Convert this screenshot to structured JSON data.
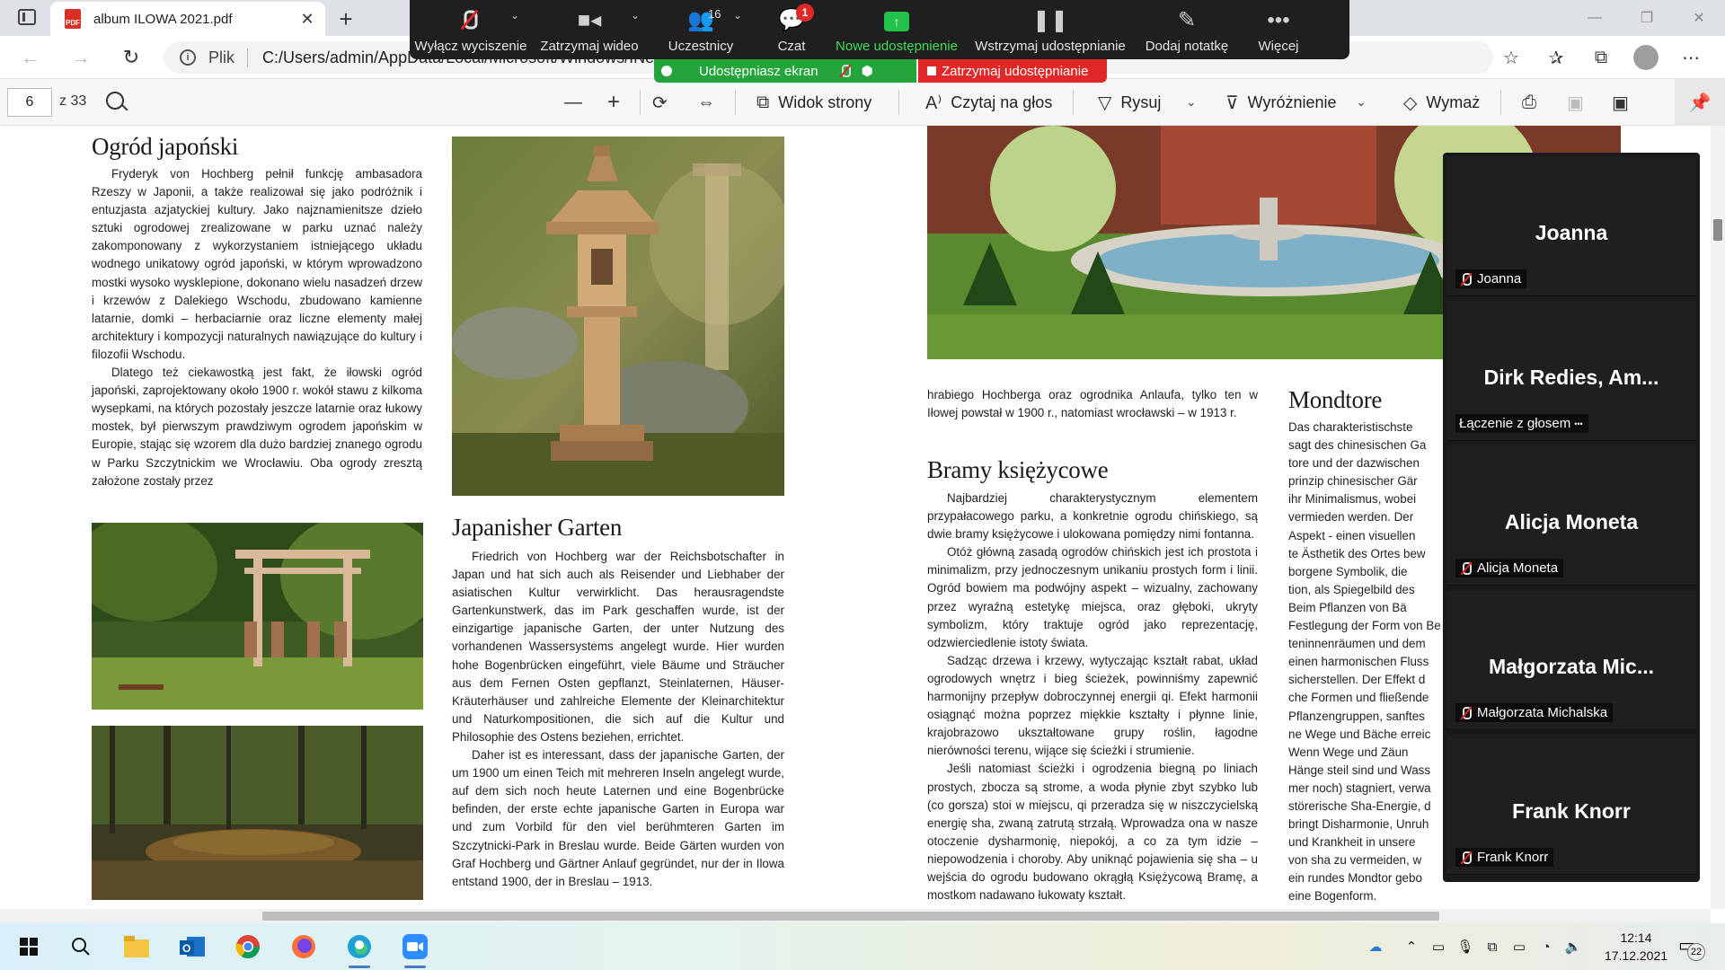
{
  "browser": {
    "tab_title": "album ILOWA 2021.pdf",
    "url_scheme": "Plik",
    "url": "C:/Users/admin/AppData/Local/Microsoft/Windows/INetCache/IE/album%20ILOWA%202021.pdf"
  },
  "pdf_toolbar": {
    "page_current": "6",
    "page_total": "z 33",
    "page_view": "Widok strony",
    "read_aloud": "Czytaj na głos",
    "draw": "Rysuj",
    "highlight": "Wyróżnienie",
    "erase": "Wymaż"
  },
  "zoom_bar": {
    "unmute": "Wyłącz wyciszenie",
    "stop_video": "Zatrzymaj wideo",
    "participants": "Uczestnicy",
    "participants_count": "16",
    "chat": "Czat",
    "chat_badge": "1",
    "new_share": "Nowe udostępnienie",
    "pause_share": "Wstrzymaj udostępnianie",
    "annotate": "Dodaj notatkę",
    "more": "Więcej",
    "sharing_status": "Udostępniasz ekran",
    "stop_sharing": "Zatrzymaj udostępnianie"
  },
  "document": {
    "left_page": {
      "title_pl": "Ogród japoński",
      "text_pl": [
        "Fryderyk von Hochberg pełnił funkcję ambasadora Rzeszy w Japonii, a także realizował się jako podróżnik i entuzjasta azjatyckiej kultury. Jako najznamienitsze dzieło sztuki ogrodowej zrealizowane w parku uznać należy zakomponowany z wykorzystaniem istniejącego układu wodnego unikatowy ogród japoński, w którym wprowadzono mostki wysoko wysklepione, dokonano wielu nasadzeń drzew i krzewów z Dalekiego Wschodu, zbudowano kamienne latarnie, domki – herbaciarnie oraz liczne elementy małej architektury i kompozycji naturalnych nawiązujące do kultury i filozofii Wschodu.",
        "Dlatego też ciekawostką jest fakt, że iłowski ogród japoński, zaprojektowany około 1900 r. wokół stawu z kilkoma wysepkami, na których pozostały jeszcze latarnie oraz łukowy mostek, był pierwszym prawdziwym ogrodem japońskim w Europie, stając się wzorem dla dużo bardziej znanego ogrodu w Parku Szczytnickim we Wrocławiu. Oba ogrody zresztą założone zostały przez"
      ],
      "title_de": "Japanisher Garten",
      "text_de": [
        "Friedrich von Hochberg war der Reichsbotschafter in Japan und hat sich auch als Reisender und Liebhaber der asiatischen Kultur verwirklicht. Das herausragendste Gartenkunstwerk, das im Park geschaffen wurde, ist der einzigartige japanische Garten, der unter Nutzung des vorhandenen Wassersystems angelegt wurde. Hier wurden hohe Bogenbrücken eingeführt, viele Bäume und Sträucher aus dem Fernen Osten gepflanzt, Steinlaternen, Häuser-Kräuterhäuser und zahlreiche Elemente der Kleinarchitektur und Naturkompositionen, die sich auf die Kultur und Philosophie des Ostens beziehen, errichtet.",
        "Daher ist es interessant, dass der japanische Garten, der um 1900 um einen Teich mit mehreren Inseln angelegt wurde, auf dem sich noch heute Laternen und eine Bogenbrücke befinden, der erste echte japanische Garten in Europa war und zum Vorbild für den viel berühmteren Garten im Szczytnicki-Park in Breslau wurde. Beide Gärten wurden von Graf Hochberg und Gärtner Anlauf gegründet, nur der in Ilowa entstand 1900, der in Breslau – 1913."
      ]
    },
    "right_page": {
      "text_cont": "hrabiego Hochberga oraz ogrodnika Anlaufa, tylko ten w Iłowej powstał w 1900 r., natomiast wrocławski – w 1913 r.",
      "title_pl": "Bramy księżycowe",
      "text_pl": [
        "Najbardziej charakterystycznym elementem przypałacowego parku, a konkretnie ogrodu chińskiego, są dwie bramy księżycowe i ulokowana pomiędzy nimi fontanna.",
        "Otóż główną zasadą ogrodów chińskich jest ich prostota i minimalizm, przy jednoczesnym unikaniu prostych form i linii. Ogród bowiem ma podwójny aspekt – wizualny, zachowany przez wyraźną estetykę miejsca, oraz głęboki, ukryty symbolizm, który traktuje ogród jako reprezentację, odzwierciedlenie istoty świata.",
        "Sadząc drzewa i krzewy, wytyczając kształt rabat, układ ogrodowych wnętrz i bieg ścieżek, powinniśmy zapewnić harmonijny przepływ dobroczynnej energii qi. Efekt harmonii osiągnąć można poprzez miękkie kształty i płynne linie, krajobrazowo ukształtowane grupy roślin, łagodne nierówności terenu, wijące się ścieżki i strumienie.",
        "Jeśli natomiast ścieżki i ogrodzenia biegną po liniach prostych, zbocza są strome, a woda płynie zbyt szybko lub (co gorsza) stoi w miejscu, qi przeradza się w niszczycielską energię sha, zwaną zatrutą strzałą. Wprowadza ona w nasze otoczenie dysharmonię, niepokój, a co za tym idzie – niepowodzenia i choroby. Aby uniknąć pojawienia się sha – u wejścia do ogrodu budowano okrągłą Księżycową Bramę, a mostkom nadawano łukowaty kształt."
      ],
      "title_de": "Mondtore",
      "text_de_lines": [
        "Das charakteristischste",
        "sagt des chinesischen Ga",
        "tore und der dazwischen",
        "prinzip chinesischer Gär",
        "ihr Minimalismus, wobei",
        "vermieden werden. Der",
        "Aspekt - einen visuellen",
        "te Ästhetik des Ortes bew",
        "borgene Symbolik, die",
        "tion, als Spiegelbild des",
        "Beim Pflanzen von Bä",
        "Festlegung der Form von Be",
        "teninnenräumen und dem",
        "einen harmonischen Fluss",
        "sicherstellen. Der Effekt d",
        "che Formen und fließende",
        "Pflanzengruppen, sanftes",
        "ne Wege und Bäche erreic",
        "Wenn Wege und Zäun",
        "Hänge steil sind und Wass",
        "mer noch) stagniert, verwa",
        "störerische Sha-Energie, d",
        "bringt Disharmonie, Unruh",
        "und Krankheit in unsere",
        "von sha zu vermeiden, w",
        "ein rundes Mondtor gebo",
        "eine Bogenform."
      ]
    }
  },
  "participants": [
    {
      "big": "Joanna",
      "small": "Joanna",
      "muted": true
    },
    {
      "big": "Dirk  Redies,  Am...",
      "small": "Łączenie z głosem",
      "muted": false
    },
    {
      "big": "Alicja Moneta",
      "small": "Alicja Moneta",
      "muted": true
    },
    {
      "big": "Małgorzata  Mic...",
      "small": "Małgorzata Michalska",
      "muted": true
    },
    {
      "big": "Frank Knorr",
      "small": "Frank Knorr",
      "muted": true
    }
  ],
  "taskbar": {
    "time": "12:14",
    "date": "17.12.2021",
    "notifications": "22"
  },
  "colors": {
    "zoom_green": "#23c04a",
    "zoom_red": "#e02828",
    "zoom_dark": "#1f1f1f"
  }
}
